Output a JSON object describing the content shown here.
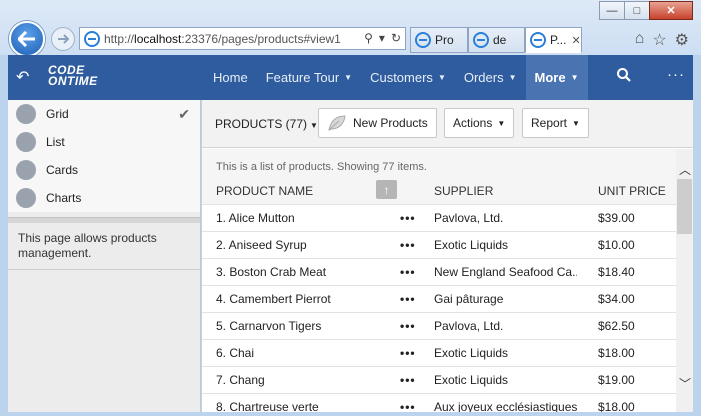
{
  "browser": {
    "url_prefix": "http://",
    "url_host": "localhost",
    "url_rest": ":23376/pages/products#view1",
    "tabs": [
      {
        "label": "Pro"
      },
      {
        "label": "de"
      },
      {
        "label": "P...",
        "close": "✕"
      }
    ],
    "window_buttons": {
      "minimize": "—",
      "maximize": "□",
      "close": "✕"
    }
  },
  "header": {
    "logo_line1": "CODE",
    "logo_line2": "ONTIME",
    "menu": [
      {
        "label": "Home",
        "caret": ""
      },
      {
        "label": "Feature Tour",
        "caret": "▼"
      },
      {
        "label": "Customers",
        "caret": "▼"
      },
      {
        "label": "Orders",
        "caret": "▼"
      },
      {
        "label": "More",
        "caret": "▼"
      }
    ],
    "more_dots": "···"
  },
  "sidebar": {
    "views": [
      {
        "label": "Grid",
        "checked": "✔"
      },
      {
        "label": "List",
        "checked": ""
      },
      {
        "label": "Cards",
        "checked": ""
      },
      {
        "label": "Charts",
        "checked": ""
      }
    ],
    "note": "This page allows products management."
  },
  "toolbar": {
    "title": "PRODUCTS (77)",
    "new_label": "New Products",
    "actions_label": "Actions",
    "report_label": "Report"
  },
  "grid": {
    "description": "This is a list of products. Showing 77 items.",
    "columns": {
      "name": "PRODUCT NAME",
      "supplier": "SUPPLIER",
      "price": "UNIT PRICE"
    },
    "more_glyph": "•••",
    "rows": [
      {
        "name": "1. Alice Mutton",
        "supplier": "Pavlova, Ltd.",
        "price": "$39.00"
      },
      {
        "name": "2. Aniseed Syrup",
        "supplier": "Exotic Liquids",
        "price": "$10.00"
      },
      {
        "name": "3. Boston Crab Meat",
        "supplier": "New England Seafood Ca...",
        "price": "$18.40"
      },
      {
        "name": "4. Camembert Pierrot",
        "supplier": "Gai pâturage",
        "price": "$34.00"
      },
      {
        "name": "5. Carnarvon Tigers",
        "supplier": "Pavlova, Ltd.",
        "price": "$62.50"
      },
      {
        "name": "6. Chai",
        "supplier": "Exotic Liquids",
        "price": "$18.00"
      },
      {
        "name": "7. Chang",
        "supplier": "Exotic Liquids",
        "price": "$19.00"
      },
      {
        "name": "8. Chartreuse verte",
        "supplier": "Aux joyeux ecclésiastiques",
        "price": "$18.00"
      }
    ]
  },
  "colors": {
    "appbar": "#2f5c9e",
    "accent": "#4a74b1"
  }
}
